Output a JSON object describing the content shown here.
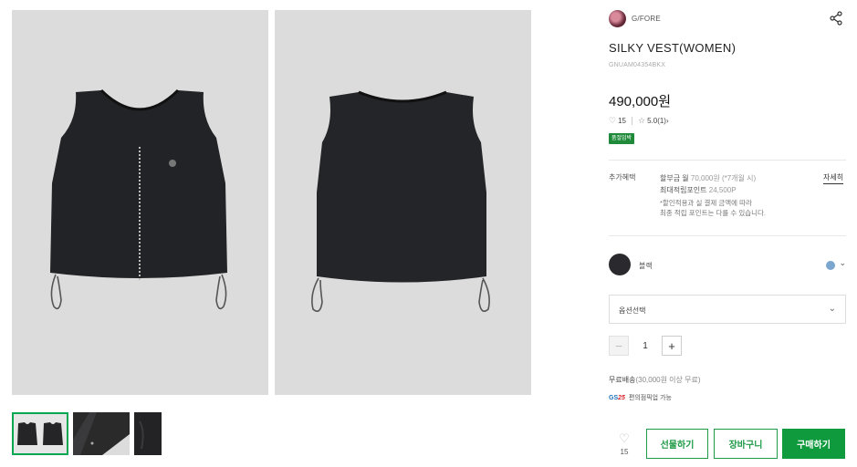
{
  "images": {
    "main_front_alt": "SILKY VEST front view",
    "main_back_alt": "SILKY VEST back view"
  },
  "brand": {
    "name": "G/FORE",
    "logo_icon": "brand-logo-icon"
  },
  "product": {
    "title": "SILKY VEST(WOMEN)",
    "sku": "GNUAM04354BKX",
    "price": "490,000원",
    "likes": "15",
    "rating": "5.0",
    "reviews": "(1)",
    "review_arrow": "›",
    "badge": "품절임박"
  },
  "benefit": {
    "label": "추가혜택",
    "installment_prefix": "할부금 월 ",
    "installment_value": "70,000원 (*7개월 시)",
    "points_prefix": "최대적립포인트 ",
    "points_value": "24,500P",
    "note_line1": "*할인적용과 실 결제 금액에 따라",
    "note_line2": "최종 적립 포인트는 다를 수 있습니다.",
    "detail_link": "자세히"
  },
  "color": {
    "name": "블랙",
    "swatch_color": "#2a2a2e",
    "chevron": "⌄"
  },
  "option": {
    "placeholder": "옵션선택",
    "chevron": "⌄"
  },
  "quantity": {
    "minus": "−",
    "value": "1",
    "plus": "+"
  },
  "shipping": {
    "label": "무료배송",
    "condition": "(30,000원 이상 무료)",
    "pickup_brand": "GS",
    "pickup_num": "25",
    "pickup_text": "편의점픽업 가능"
  },
  "actions": {
    "wish_count": "15",
    "gift": "선물하기",
    "cart": "장바구니",
    "buy": "구매하기"
  },
  "colors": {
    "accent": "#0f9a3e",
    "badge": "#1e8a3a"
  }
}
